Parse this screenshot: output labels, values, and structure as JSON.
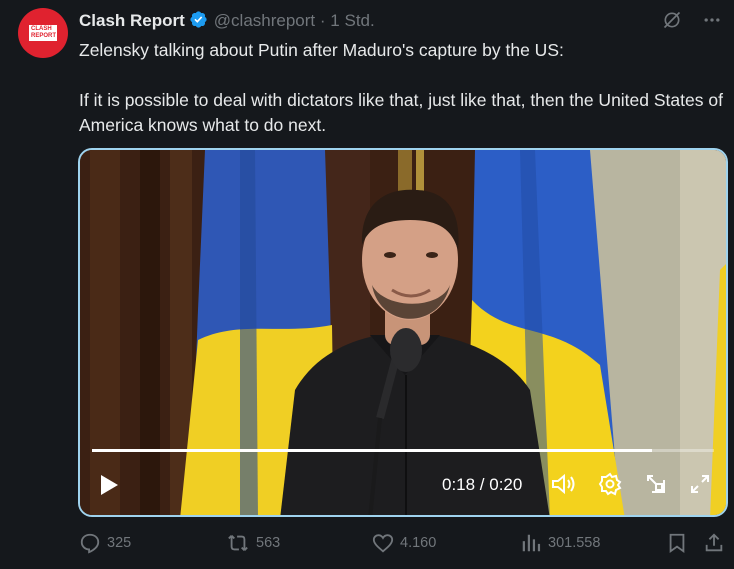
{
  "author": {
    "name": "Clash Report",
    "handle": "@clashreport",
    "separator": "·",
    "time": "1 Std.",
    "avatar_text": "CLASH REPORT"
  },
  "tweet": {
    "text": "Zelensky talking about Putin after Maduro's capture by the US:\n\nIf it is possible to deal with dictators like that, just like that, then the United States of America knows what to do next."
  },
  "video": {
    "current_time": "0:18",
    "duration": "0:20",
    "time_display": "0:18 / 0:20",
    "progress": 0.9
  },
  "actions": {
    "replies": "325",
    "reposts": "563",
    "likes": "4.160",
    "views": "301.558"
  },
  "colors": {
    "background": "#15181c",
    "verified": "#1d9bf0",
    "brand_red": "#e0222f",
    "muted": "#71767b",
    "video_focus_border": "#9fd3ee"
  },
  "icons": {
    "verified": "verified-badge-icon",
    "grok": "grok-icon",
    "more": "more-icon",
    "play": "play-icon",
    "volume": "volume-icon",
    "settings": "settings-icon",
    "pip": "picture-in-picture-icon",
    "fullscreen": "fullscreen-icon",
    "reply": "reply-icon",
    "repost": "repost-icon",
    "like": "like-icon",
    "views": "views-icon",
    "bookmark": "bookmark-icon",
    "share": "share-icon"
  }
}
